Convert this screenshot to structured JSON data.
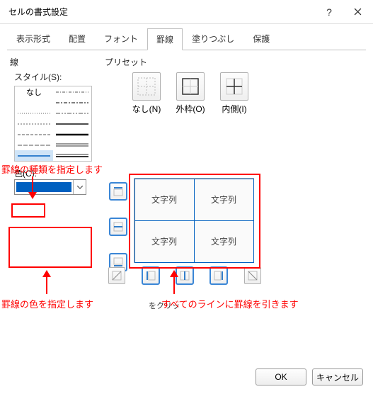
{
  "colors": {
    "blue": "#0060c0",
    "red": "#ff0000"
  },
  "titlebar": {
    "title": "セルの書式設定"
  },
  "tabs": {
    "items": [
      {
        "label": "表示形式"
      },
      {
        "label": "配置"
      },
      {
        "label": "フォント"
      },
      {
        "label": "罫線"
      },
      {
        "label": "塗りつぶし"
      },
      {
        "label": "保護"
      }
    ],
    "active_index": 3
  },
  "line": {
    "section_label": "線",
    "style_label": "スタイル(S):",
    "options": {
      "none_label": "なし"
    },
    "color_label": "色(C):"
  },
  "preset": {
    "section_label": "プリセット",
    "items": [
      {
        "label": "なし(N)"
      },
      {
        "label": "外枠(O)"
      },
      {
        "label": "内側(I)"
      }
    ]
  },
  "preview": {
    "cells": [
      "文字列",
      "文字列",
      "文字列",
      "文字列"
    ]
  },
  "click_note": "をクリッ",
  "annotations": {
    "style_note": "罫線の種類を指定します",
    "color_note": "罫線の色を指定します",
    "all_lines_note": "すべてのラインに罫線を引きます"
  },
  "buttons": {
    "ok": "OK",
    "cancel": "キャンセル"
  }
}
